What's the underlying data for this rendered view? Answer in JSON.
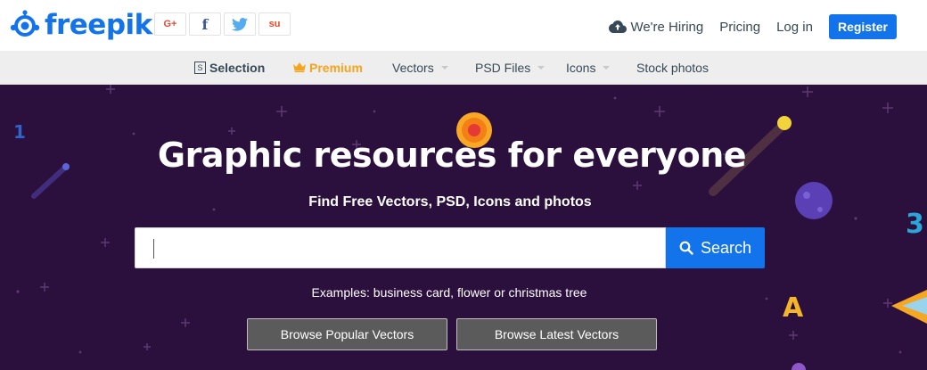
{
  "brand": {
    "name": "freepik",
    "color": "#1273eb"
  },
  "social": [
    {
      "name": "google-plus",
      "glyph": "G+",
      "color": "#dd4b39"
    },
    {
      "name": "facebook",
      "glyph": "f",
      "color": "#3b5998"
    },
    {
      "name": "twitter",
      "glyph": "t",
      "color": "#55acee"
    },
    {
      "name": "stumbleupon",
      "glyph": "su",
      "color": "#eb4924"
    }
  ],
  "nav": {
    "hiring": "We're Hiring",
    "pricing": "Pricing",
    "login": "Log in",
    "register": "Register"
  },
  "categories": {
    "selection_box": "S",
    "selection": "Selection",
    "premium": "Premium",
    "vectors": "Vectors",
    "psd": "PSD Files",
    "icons": "Icons",
    "stock": "Stock photos"
  },
  "hero": {
    "title": "Graphic resources for everyone",
    "subtitle": "Find Free Vectors, PSD, Icons and photos",
    "search_value": "",
    "search_button": "Search",
    "examples": "Examples: business card, flower or christmas tree",
    "browse_popular": "Browse Popular Vectors",
    "browse_latest": "Browse Latest Vectors"
  },
  "decor": {
    "one": "1",
    "three": "3",
    "letter_a": "A"
  },
  "colors": {
    "accent": "#1273eb",
    "premium": "#f7a31c",
    "hero_bg": "#2b0f3c"
  }
}
